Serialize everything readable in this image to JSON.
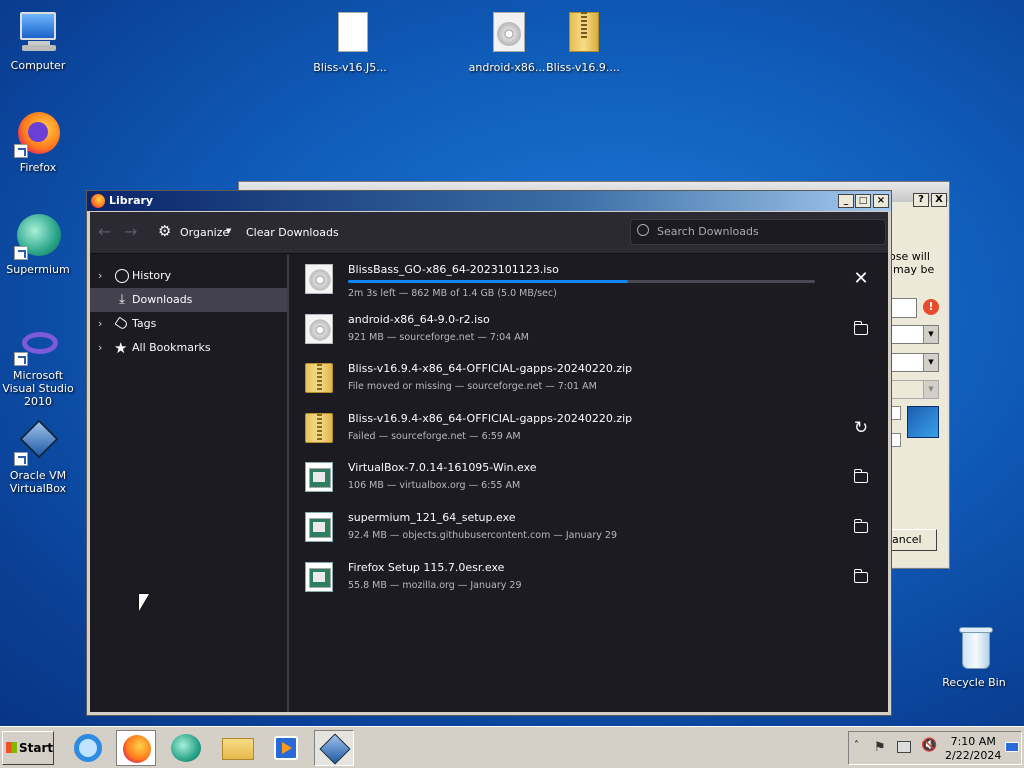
{
  "desktop": {
    "icons": [
      {
        "label": "Computer"
      },
      {
        "label": "Firefox"
      },
      {
        "label": "Supermium"
      },
      {
        "label": "Microsoft Visual Studio 2010"
      },
      {
        "label": "Oracle VM VirtualBox"
      },
      {
        "label": "Bliss-v16.J5..."
      },
      {
        "label": "android-x86..."
      },
      {
        "label": "Bliss-v16.9...."
      },
      {
        "label": "Recycle Bin"
      }
    ]
  },
  "back_dialog": {
    "text1": "ose will",
    "text2": "may be",
    "cancel_label": "ancel",
    "help_btn": "?",
    "close_btn": "X"
  },
  "library": {
    "title": "Library",
    "toolbar": {
      "organize_label": "Organize",
      "clear_label": "Clear Downloads",
      "search_placeholder": "Search Downloads"
    },
    "sidebar": [
      {
        "label": "History"
      },
      {
        "label": "Downloads"
      },
      {
        "label": "Tags"
      },
      {
        "label": "All Bookmarks"
      }
    ],
    "downloads": [
      {
        "name": "BlissBass_GO-x86_64-2023101123.iso",
        "status": "2m 3s left — 862 MB of 1.4 GB (5.0 MB/sec)",
        "progress": 0.6,
        "action": "cancel"
      },
      {
        "name": "android-x86_64-9.0-r2.iso",
        "status": "921 MB — sourceforge.net — 7:04 AM",
        "action": "show-in-folder"
      },
      {
        "name": "Bliss-v16.9.4-x86_64-OFFICIAL-gapps-20240220.zip",
        "status": "File moved or missing — sourceforge.net — 7:01 AM",
        "action": "none"
      },
      {
        "name": "Bliss-v16.9.4-x86_64-OFFICIAL-gapps-20240220.zip",
        "status": "Failed — sourceforge.net — 6:59 AM",
        "action": "retry"
      },
      {
        "name": "VirtualBox-7.0.14-161095-Win.exe",
        "status": "106 MB — virtualbox.org — 6:55 AM",
        "action": "show-in-folder"
      },
      {
        "name": "supermium_121_64_setup.exe",
        "status": "92.4 MB — objects.githubusercontent.com — January 29",
        "action": "show-in-folder"
      },
      {
        "name": "Firefox Setup 115.7.0esr.exe",
        "status": "55.8 MB — mozilla.org — January 29",
        "action": "show-in-folder"
      }
    ]
  },
  "taskbar": {
    "start_label": "Start",
    "time": "7:10 AM",
    "date": "2/22/2024"
  }
}
